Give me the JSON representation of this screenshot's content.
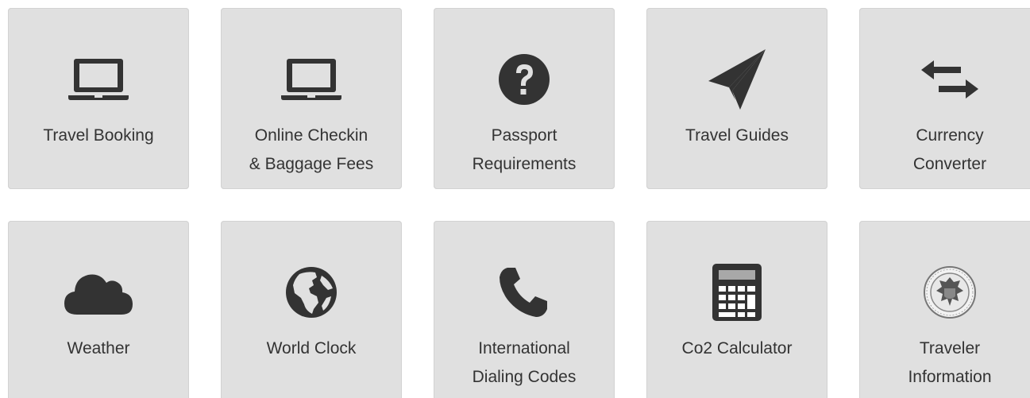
{
  "tiles": [
    {
      "label": "Travel Booking",
      "icon": "laptop-icon"
    },
    {
      "label": "Online Checkin\n& Baggage Fees",
      "icon": "laptop-icon"
    },
    {
      "label": "Passport\nRequirements",
      "icon": "question-circle-icon"
    },
    {
      "label": "Travel Guides",
      "icon": "paper-plane-icon"
    },
    {
      "label": "Currency\nConverter",
      "icon": "exchange-arrows-icon"
    },
    {
      "label": "Weather",
      "icon": "cloud-icon"
    },
    {
      "label": "World Clock",
      "icon": "globe-icon"
    },
    {
      "label": "International\nDialing Codes",
      "icon": "phone-icon"
    },
    {
      "label": "Co2 Calculator",
      "icon": "calculator-icon"
    },
    {
      "label": "Traveler\nInformation",
      "icon": "homeland-security-seal-icon"
    }
  ],
  "colors": {
    "tile_background": "#e0e0e0",
    "icon": "#333333",
    "text": "#333333"
  }
}
